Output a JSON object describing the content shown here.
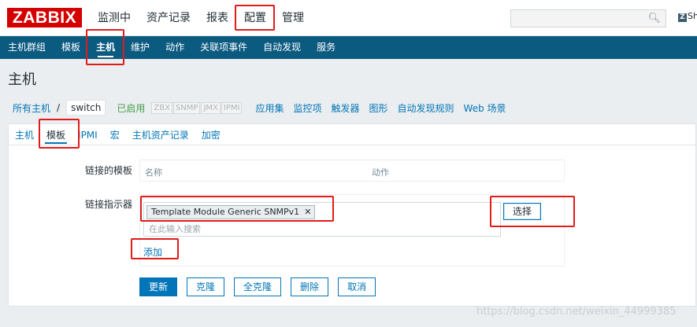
{
  "header": {
    "logo": "ZABBIX",
    "nav": [
      "监测中",
      "资产记录",
      "报表",
      "配置",
      "管理"
    ],
    "selected_nav": "配置",
    "search_placeholder": "",
    "share_label": "Sh"
  },
  "subnav": {
    "items": [
      "主机群组",
      "模板",
      "主机",
      "维护",
      "动作",
      "关联项事件",
      "自动发现",
      "服务"
    ],
    "active": "主机"
  },
  "page_title": "主机",
  "breadcrumb": {
    "all_hosts": "所有主机",
    "separator": "/",
    "current_host": "switch",
    "status": "已启用",
    "availability": [
      "ZBX",
      "SNMP",
      "JMX",
      "IPMI"
    ],
    "links": [
      "应用集",
      "监控项",
      "触发器",
      "图形",
      "自动发现规则",
      "Web 场景"
    ]
  },
  "form_tabs": [
    "主机",
    "模板",
    "IPMI",
    "宏",
    "主机资产记录",
    "加密"
  ],
  "form": {
    "linked_templates_label": "链接的模板",
    "linked_col_name": "名称",
    "linked_col_action": "动作",
    "link_new_label": "链接指示器",
    "selected_template": "Template Module Generic SNMPv1",
    "remove_symbol": "✕",
    "search_placeholder": "在此输入搜索",
    "select_button": "选择",
    "add_link": "添加"
  },
  "buttons": [
    "更新",
    "克隆",
    "全克隆",
    "删除",
    "取消"
  ],
  "watermark": "https://blog.csdn.net/weixin_44999385",
  "colors": {
    "brand_red": "#d40000",
    "subnav_blue": "#0b5a80",
    "link_blue": "#0275b8",
    "enabled_green": "#429e47",
    "annotation_red": "#e11b1b"
  }
}
